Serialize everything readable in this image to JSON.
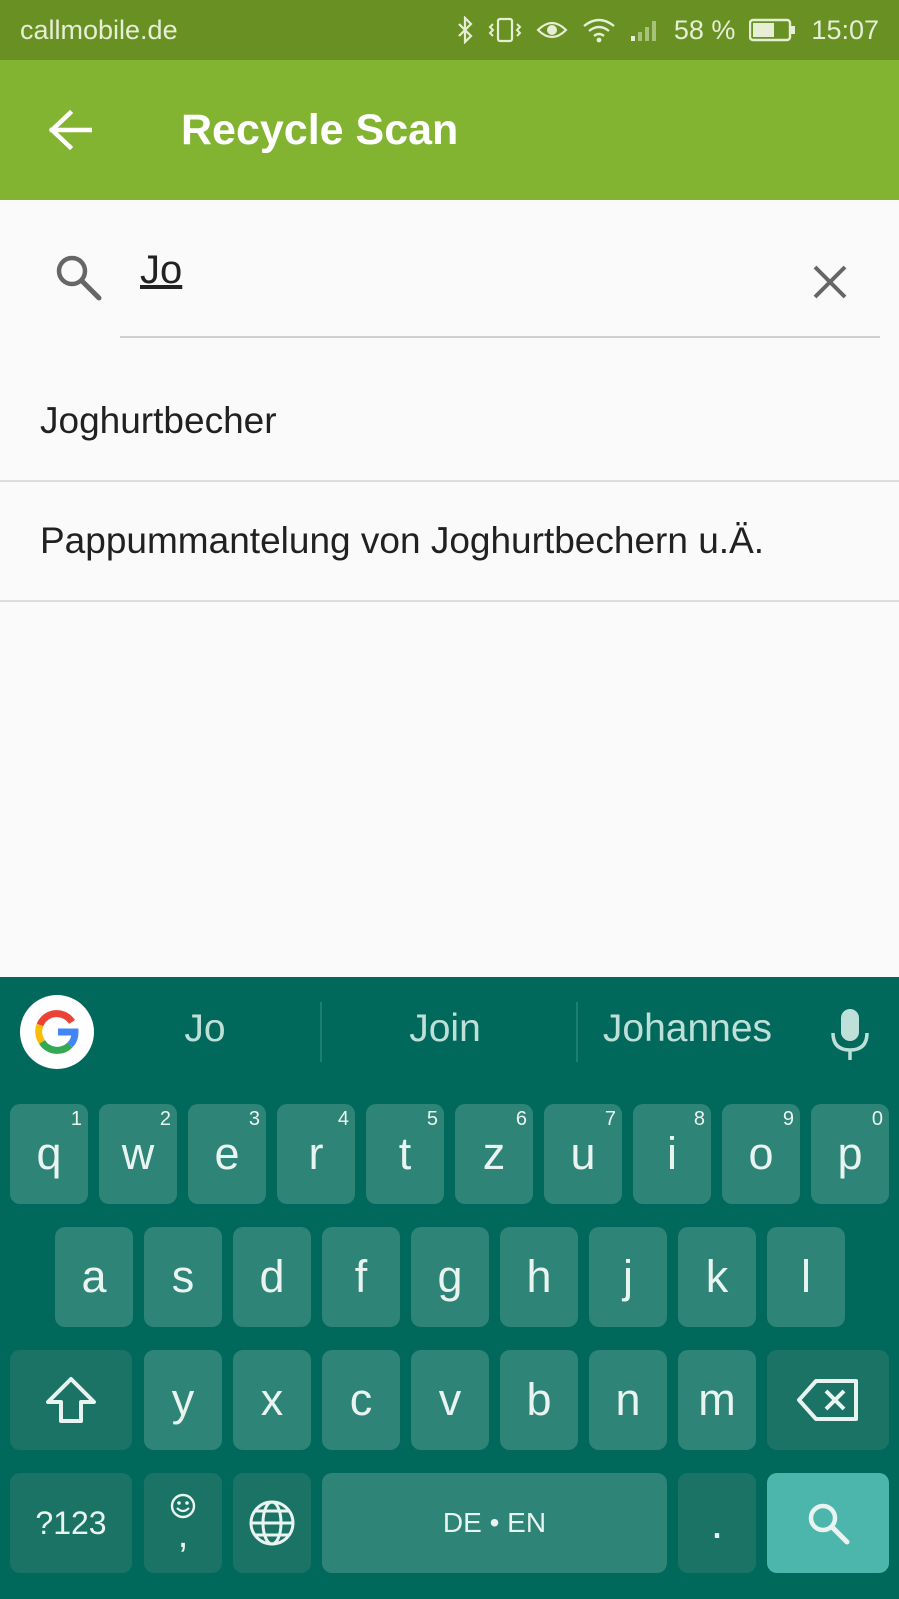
{
  "status_bar": {
    "carrier": "callmobile.de",
    "battery": "58 %",
    "time": "15:07",
    "icons": [
      "bluetooth-icon",
      "vibrate-icon",
      "eye-icon",
      "wifi-icon",
      "signal-icon",
      "battery-icon"
    ]
  },
  "app_bar": {
    "title": "Recycle Scan",
    "back_icon": "arrow-left-icon"
  },
  "search": {
    "query": "Jo",
    "search_icon": "search-icon",
    "clear_icon": "close-icon"
  },
  "results": [
    "Joghurtbecher",
    "Pappummantelung von Joghurtbechern u.Ä."
  ],
  "keyboard": {
    "suggestions": [
      "Jo",
      "Join",
      "Johannes"
    ],
    "row1": [
      {
        "key": "q",
        "num": "1"
      },
      {
        "key": "w",
        "num": "2"
      },
      {
        "key": "e",
        "num": "3"
      },
      {
        "key": "r",
        "num": "4"
      },
      {
        "key": "t",
        "num": "5"
      },
      {
        "key": "z",
        "num": "6"
      },
      {
        "key": "u",
        "num": "7"
      },
      {
        "key": "i",
        "num": "8"
      },
      {
        "key": "o",
        "num": "9"
      },
      {
        "key": "p",
        "num": "0"
      }
    ],
    "row2": [
      "a",
      "s",
      "d",
      "f",
      "g",
      "h",
      "j",
      "k",
      "l"
    ],
    "row3": [
      "y",
      "x",
      "c",
      "v",
      "b",
      "n",
      "m"
    ],
    "symbols_key": "?123",
    "comma_key": ",",
    "space_label": "DE • EN",
    "period_key": ".",
    "colors": {
      "background": "#00695c",
      "key": "#2e8476",
      "accent": "#4db6ac"
    }
  },
  "colors": {
    "app_bar": "#82b431",
    "status_bar": "#689022"
  }
}
